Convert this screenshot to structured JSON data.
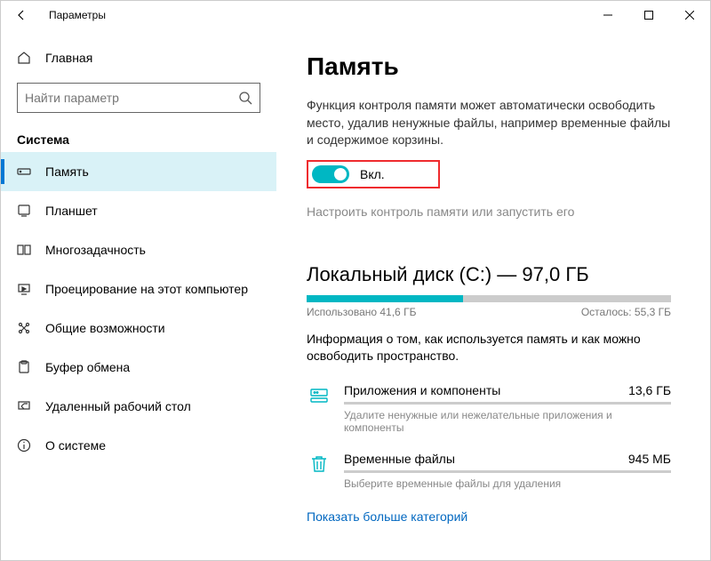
{
  "titlebar": {
    "title": "Параметры"
  },
  "sidebar": {
    "home": "Главная",
    "search_placeholder": "Найти параметр",
    "section": "Система",
    "items": [
      {
        "label": "Память"
      },
      {
        "label": "Планшет"
      },
      {
        "label": "Многозадачность"
      },
      {
        "label": "Проецирование на этот компьютер"
      },
      {
        "label": "Общие возможности"
      },
      {
        "label": "Буфер обмена"
      },
      {
        "label": "Удаленный рабочий стол"
      },
      {
        "label": "О системе"
      }
    ]
  },
  "main": {
    "title": "Память",
    "desc": "Функция контроля памяти может автоматически освободить место, удалив ненужные файлы, например временные файлы и содержимое корзины.",
    "toggle_label": "Вкл.",
    "configure_link": "Настроить контроль памяти или запустить его",
    "disk_title": "Локальный диск (C:) — 97,0 ГБ",
    "used_label": "Использовано 41,6 ГБ",
    "remaining_label": "Осталось: 55,3 ГБ",
    "fill_percent": 43,
    "disk_desc": "Информация о том, как используется память и как можно освободить пространство.",
    "categories": [
      {
        "name": "Приложения и компоненты",
        "size": "13,6 ГБ",
        "hint": "Удалите ненужные или нежелательные приложения и компоненты"
      },
      {
        "name": "Временные файлы",
        "size": "945 МБ",
        "hint": "Выберите временные файлы для удаления"
      }
    ],
    "show_more": "Показать больше категорий"
  }
}
